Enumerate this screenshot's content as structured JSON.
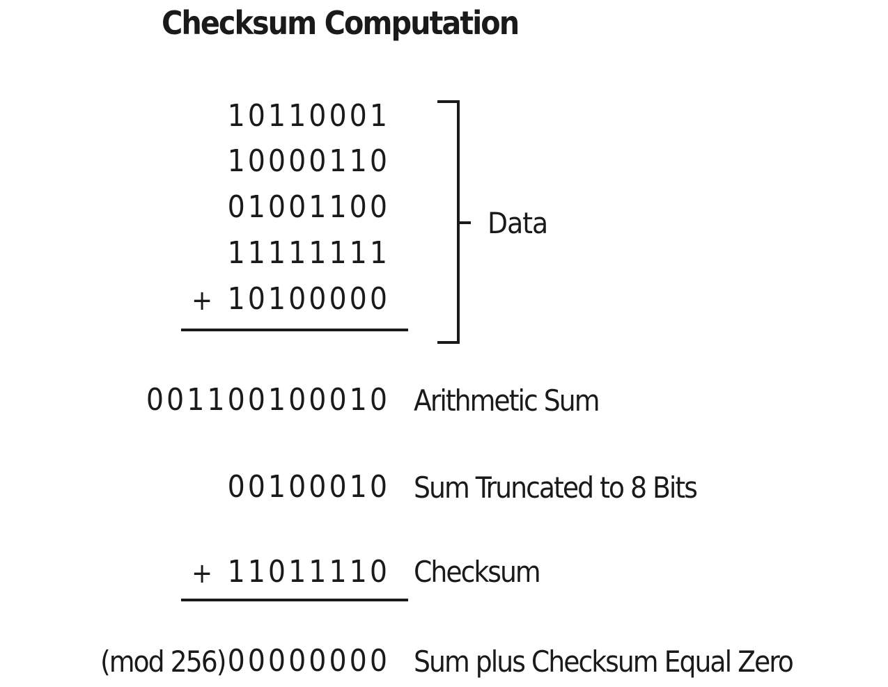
{
  "title": "Checksum Computation",
  "data_bytes": [
    "10110001",
    "10000110",
    "01001100",
    "11111111",
    "10100000"
  ],
  "plus_sign": "+",
  "data_label": "Data",
  "arithmetic_sum": {
    "value": "001100100010",
    "label": "Arithmetic Sum"
  },
  "truncated_sum": {
    "value": "00100010",
    "label": "Sum Truncated to 8 Bits"
  },
  "checksum": {
    "sign": "+",
    "value": "11011110",
    "label": "Checksum"
  },
  "result": {
    "modulus": "(mod 256)",
    "value": "00000000",
    "label": "Sum plus Checksum Equal Zero"
  }
}
